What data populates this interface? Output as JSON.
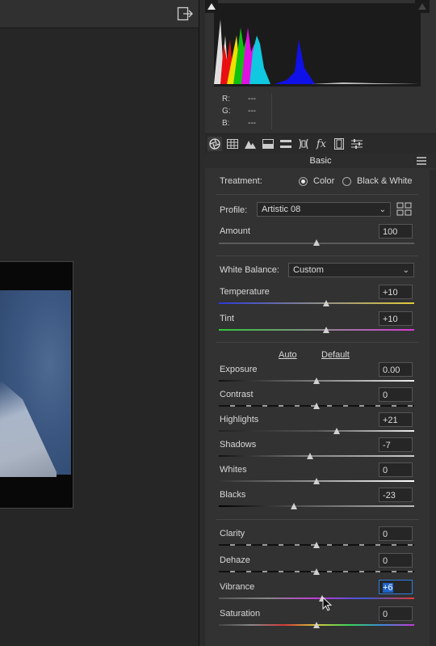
{
  "histogram": {
    "r_label": "R:",
    "g_label": "G:",
    "b_label": "B:",
    "r_value": "---",
    "g_value": "---",
    "b_value": "---"
  },
  "toolbar": {
    "tools": [
      "aperture-icon",
      "grid-icon",
      "mountains-icon",
      "split-tone-icon",
      "detail-icon",
      "lens-icon",
      "fx-icon",
      "film-icon",
      "sliders-icon"
    ]
  },
  "panel": {
    "title": "Basic",
    "treatment_label": "Treatment:",
    "treatment_color": "Color",
    "treatment_bw": "Black & White",
    "profile_label": "Profile:",
    "profile_value": "Artistic 08",
    "amount_label": "Amount",
    "amount_value": "100",
    "wb_label": "White Balance:",
    "wb_value": "Custom",
    "auto_label": "Auto",
    "default_label": "Default"
  },
  "sliders": [
    {
      "key": "amount",
      "label": "Amount",
      "value": "100",
      "pos": 0.5
    },
    {
      "key": "temperature",
      "label": "Temperature",
      "value": "+10",
      "pos": 0.55
    },
    {
      "key": "tint",
      "label": "Tint",
      "value": "+10",
      "pos": 0.55
    },
    {
      "key": "exposure",
      "label": "Exposure",
      "value": "0.00",
      "pos": 0.5
    },
    {
      "key": "contrast",
      "label": "Contrast",
      "value": "0",
      "pos": 0.5
    },
    {
      "key": "highlights",
      "label": "Highlights",
      "value": "+21",
      "pos": 0.605
    },
    {
      "key": "shadows",
      "label": "Shadows",
      "value": "-7",
      "pos": 0.465
    },
    {
      "key": "whites",
      "label": "Whites",
      "value": "0",
      "pos": 0.5
    },
    {
      "key": "blacks",
      "label": "Blacks",
      "value": "-23",
      "pos": 0.385
    },
    {
      "key": "clarity",
      "label": "Clarity",
      "value": "0",
      "pos": 0.5
    },
    {
      "key": "dehaze",
      "label": "Dehaze",
      "value": "0",
      "pos": 0.5
    },
    {
      "key": "vibrance",
      "label": "Vibrance",
      "value": "+6",
      "pos": 0.53
    },
    {
      "key": "saturation",
      "label": "Saturation",
      "value": "0",
      "pos": 0.5
    }
  ],
  "colors": {
    "panel_bg": "#323232",
    "selection": "#1e63c7"
  }
}
